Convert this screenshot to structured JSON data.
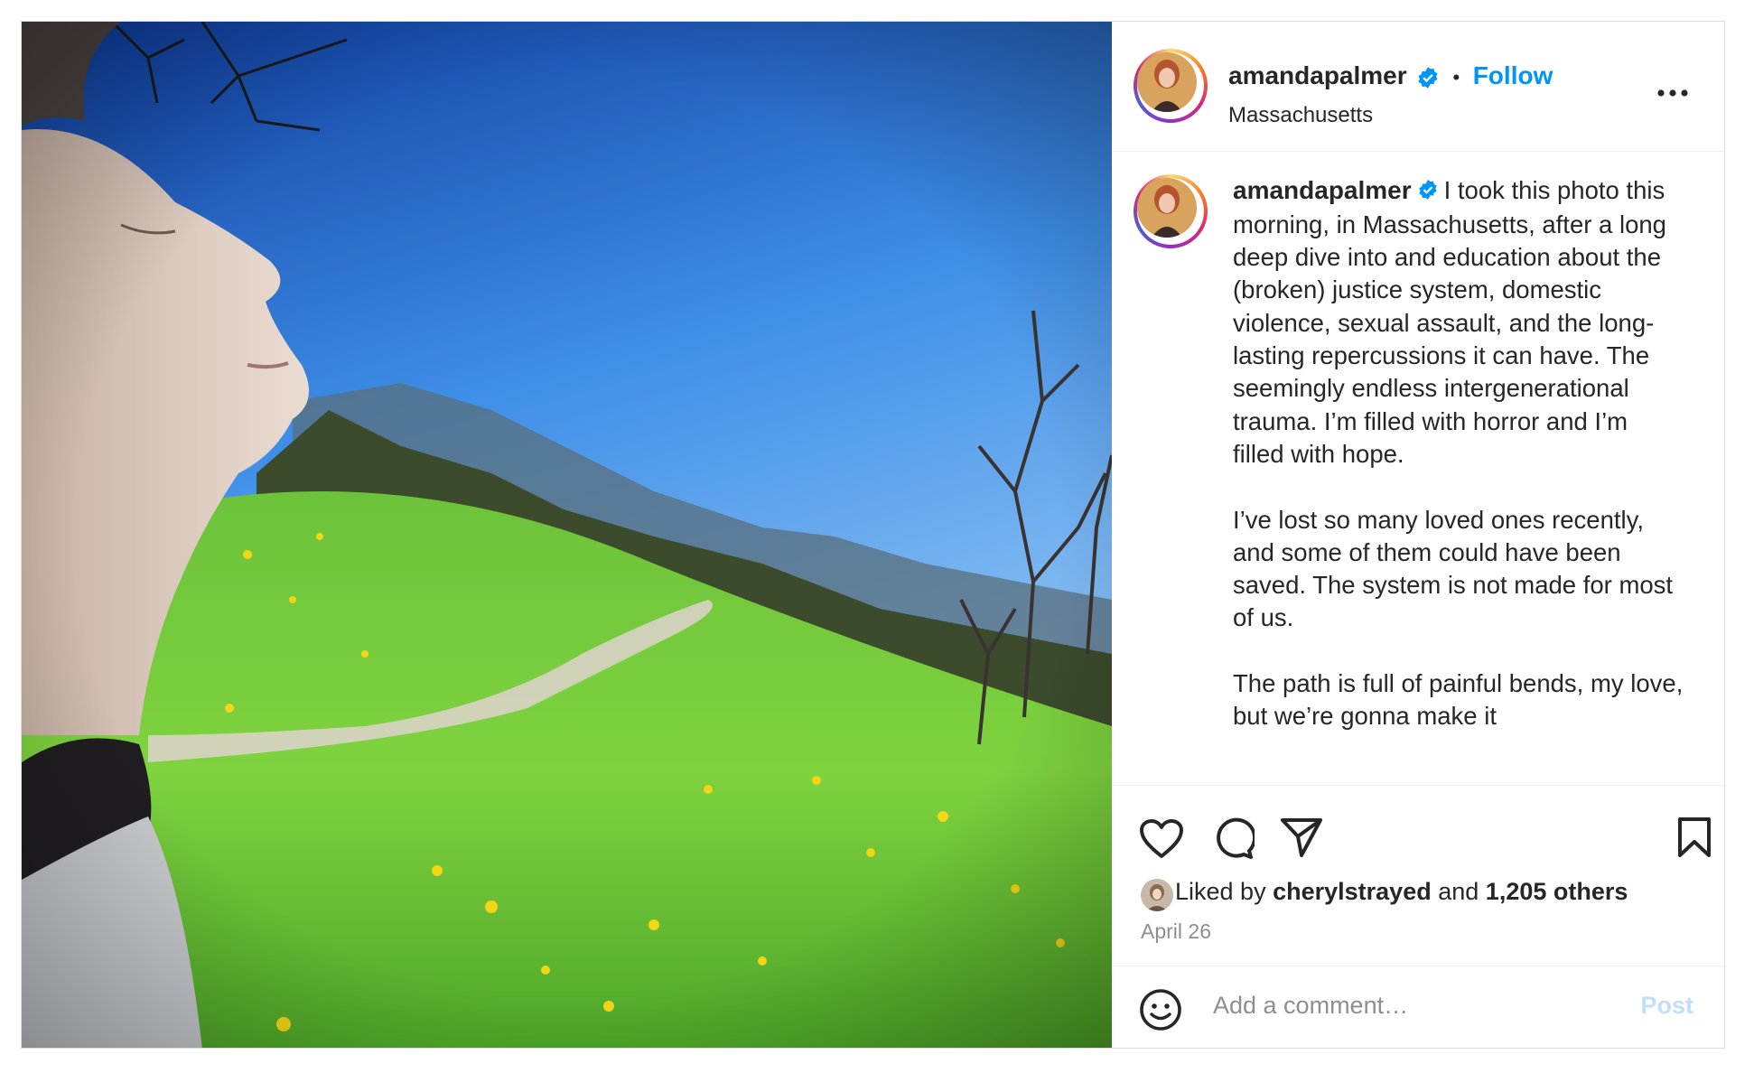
{
  "post": {
    "username": "amandapalmer",
    "follow_label": "Follow",
    "separator": "•",
    "location": "Massachusetts",
    "caption": "I took this photo this morning, in Massachusetts, after a long deep dive into and education about the (broken) justice system, domestic violence, sexual assault, and the long-lasting repercussions it can have. The seemingly endless intergenerational trauma. I’m filled with horror and I’m filled with hope.\n\nI’ve lost so many loved ones recently, and some of them could have been saved. The system is not made for most of us.\n\nThe path is full of painful bends, my love, but we’re gonna make it",
    "likes": {
      "prefix": "Liked by",
      "liker": "cherylstrayed",
      "conjunction": "and",
      "others": "1,205 others"
    },
    "date": "April 26"
  },
  "comment": {
    "placeholder": "Add a comment…",
    "post_label": "Post"
  },
  "icons": {
    "verified": "verified-badge-icon",
    "more": "more-options-icon",
    "like": "heart-icon",
    "comment": "comment-icon",
    "share": "share-icon",
    "save": "bookmark-icon",
    "emoji": "emoji-icon"
  },
  "colors": {
    "accent": "#0095f6",
    "post_disabled": "#c0dffd",
    "secondary_text": "#8e8e8e"
  }
}
